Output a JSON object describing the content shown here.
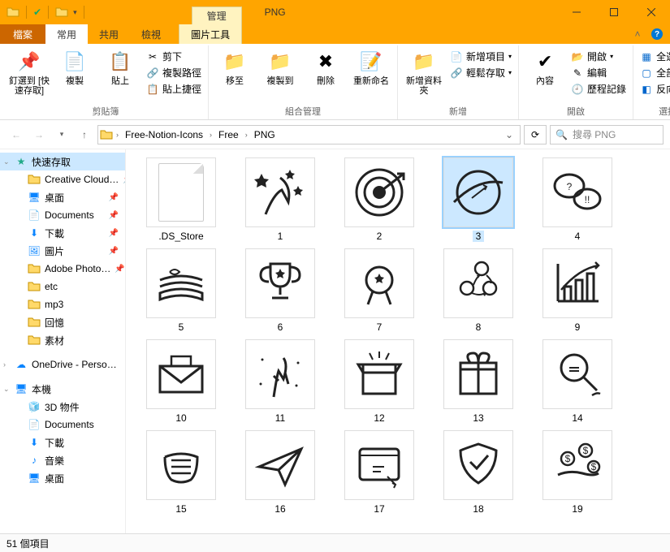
{
  "window": {
    "title": "PNG",
    "contextual_tab_header": "管理"
  },
  "title_controls": {
    "minimize": "–",
    "maximize": "▢",
    "close": "✕"
  },
  "tabs": {
    "file": "檔案",
    "home": "常用",
    "share": "共用",
    "view": "檢視",
    "picture_tools": "圖片工具"
  },
  "ribbon": {
    "group_clipboard": "剪貼簿",
    "group_organize": "組合管理",
    "group_new": "新增",
    "group_open": "開啟",
    "group_select": "選擇",
    "pin": "釘選到 [快速存取]",
    "copy": "複製",
    "paste": "貼上",
    "cut": "剪下",
    "copy_path": "複製路徑",
    "paste_shortcut": "貼上捷徑",
    "move_to": "移至",
    "copy_to": "複製到",
    "delete": "刪除",
    "rename": "重新命名",
    "new_folder": "新增資料夾",
    "new_item": "新增項目",
    "easy_access": "輕鬆存取",
    "properties": "內容",
    "open": "開啟",
    "edit": "編輯",
    "history": "歷程記錄",
    "select_all": "全選",
    "select_none": "全部不選",
    "invert_selection": "反向選擇"
  },
  "breadcrumb": {
    "root": "Free-Notion-Icons",
    "sub1": "Free",
    "sub2": "PNG"
  },
  "search": {
    "placeholder": "搜尋 PNG"
  },
  "sidebar": {
    "quick_access": "快速存取",
    "creative_cloud": "Creative Cloud…",
    "desktop": "桌面",
    "documents": "Documents",
    "downloads": "下載",
    "pictures": "圖片",
    "adobe_photoshop": "Adobe Photo…",
    "etc": "etc",
    "mp3": "mp3",
    "memories": "回憶",
    "materials": "素材",
    "onedrive": "OneDrive - Perso…",
    "this_pc": "本機",
    "objects3d": "3D 物件",
    "documents2": "Documents",
    "downloads2": "下載",
    "music": "音樂",
    "desktop2": "桌面"
  },
  "files": [
    {
      "name": ".DS_Store",
      "kind": "doc"
    },
    {
      "name": "1",
      "kind": "sketch",
      "svg": "hand-stars"
    },
    {
      "name": "2",
      "kind": "sketch",
      "svg": "target"
    },
    {
      "name": "3",
      "kind": "sketch",
      "svg": "planet",
      "selected": true
    },
    {
      "name": "4",
      "kind": "sketch",
      "svg": "chat"
    },
    {
      "name": "5",
      "kind": "sketch",
      "svg": "papers"
    },
    {
      "name": "6",
      "kind": "sketch",
      "svg": "trophy"
    },
    {
      "name": "7",
      "kind": "sketch",
      "svg": "medal"
    },
    {
      "name": "8",
      "kind": "sketch",
      "svg": "cycle"
    },
    {
      "name": "9",
      "kind": "sketch",
      "svg": "chart"
    },
    {
      "name": "10",
      "kind": "sketch",
      "svg": "envelope"
    },
    {
      "name": "11",
      "kind": "sketch",
      "svg": "rock"
    },
    {
      "name": "12",
      "kind": "sketch",
      "svg": "box"
    },
    {
      "name": "13",
      "kind": "sketch",
      "svg": "gift"
    },
    {
      "name": "14",
      "kind": "sketch",
      "svg": "magnify"
    },
    {
      "name": "15",
      "kind": "sketch",
      "svg": "hands"
    },
    {
      "name": "16",
      "kind": "sketch",
      "svg": "plane"
    },
    {
      "name": "17",
      "kind": "sketch",
      "svg": "window"
    },
    {
      "name": "18",
      "kind": "sketch",
      "svg": "shield"
    },
    {
      "name": "19",
      "kind": "sketch",
      "svg": "coins"
    }
  ],
  "status": {
    "count": "51 個項目"
  }
}
